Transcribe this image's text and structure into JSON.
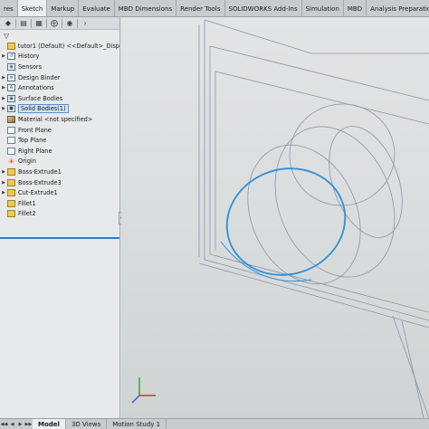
{
  "ribbon": {
    "tabs": [
      "res",
      "Sketch",
      "Markup",
      "Evaluate",
      "MBD Dimensions",
      "Render Tools",
      "SOLIDWORKS Add-Ins",
      "Simulation",
      "MBD",
      "Analysis Preparation"
    ],
    "active_tab": "Sketch"
  },
  "manager_toolbar": {
    "icons": [
      "feature-manager-icon",
      "property-manager-icon",
      "configuration-manager-icon",
      "dimxpert-icon",
      "display-manager-icon",
      "more-icon"
    ]
  },
  "feature_tree": {
    "filter_icon": "filter-icon",
    "root": "tutor1 (Default) <<Default>_Disp",
    "items": [
      {
        "label": "History",
        "icon": "history-icon",
        "arrow": true
      },
      {
        "label": "Sensors",
        "icon": "sensor-icon",
        "arrow": false
      },
      {
        "label": "Design Binder",
        "icon": "binder-icon",
        "arrow": true
      },
      {
        "label": "Annotations",
        "icon": "annotation-icon",
        "arrow": true
      },
      {
        "label": "Surface Bodies",
        "icon": "surface-bodies-icon",
        "arrow": true
      },
      {
        "label": "Solid Bodies(1)",
        "icon": "solid-bodies-icon",
        "arrow": true,
        "selected": true
      },
      {
        "label": "Material <not specified>",
        "icon": "material-icon",
        "arrow": false
      },
      {
        "label": "Front Plane",
        "icon": "plane-icon",
        "arrow": false
      },
      {
        "label": "Top Plane",
        "icon": "plane-icon",
        "arrow": false
      },
      {
        "label": "Right Plane",
        "icon": "plane-icon",
        "arrow": false
      },
      {
        "label": "Origin",
        "icon": "origin-icon",
        "arrow": false
      },
      {
        "label": "Boss-Extrude1",
        "icon": "boss-extrude-icon",
        "arrow": true
      },
      {
        "label": "Boss-Extrude3",
        "icon": "boss-extrude-icon",
        "arrow": true
      },
      {
        "label": "Cut-Extrude1",
        "icon": "cut-extrude-icon",
        "arrow": true
      },
      {
        "label": "Fillet1",
        "icon": "fillet-icon",
        "arrow": false
      },
      {
        "label": "Fillet2",
        "icon": "fillet-icon",
        "arrow": false
      }
    ]
  },
  "bottom_tabs": {
    "tabs": [
      "Model",
      "3D Views",
      "Motion Study 1"
    ],
    "active_tab": "Model"
  },
  "colors": {
    "selection_edge": "#2f8fd8",
    "wire_edge": "#8a96a6",
    "rollback_bar": "#2b7fc4"
  }
}
